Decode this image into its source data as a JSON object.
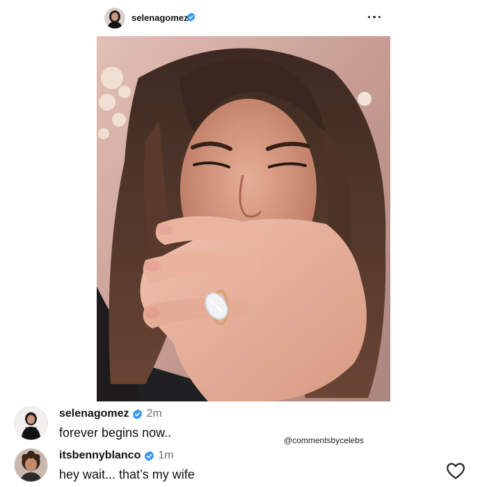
{
  "post": {
    "username": "selenagomez",
    "icons": {
      "verified": "verified-badge-icon",
      "more": "more-options-icon",
      "like": "heart-icon"
    },
    "accent_color": "#3897f0"
  },
  "comments": [
    {
      "username": "selenagomez",
      "time": "2m",
      "text": "forever begins now.."
    },
    {
      "username": "itsbennyblanco",
      "time": "1m",
      "text": "hey wait... that’s my wife"
    }
  ],
  "watermark": "@commentsbycelebs"
}
